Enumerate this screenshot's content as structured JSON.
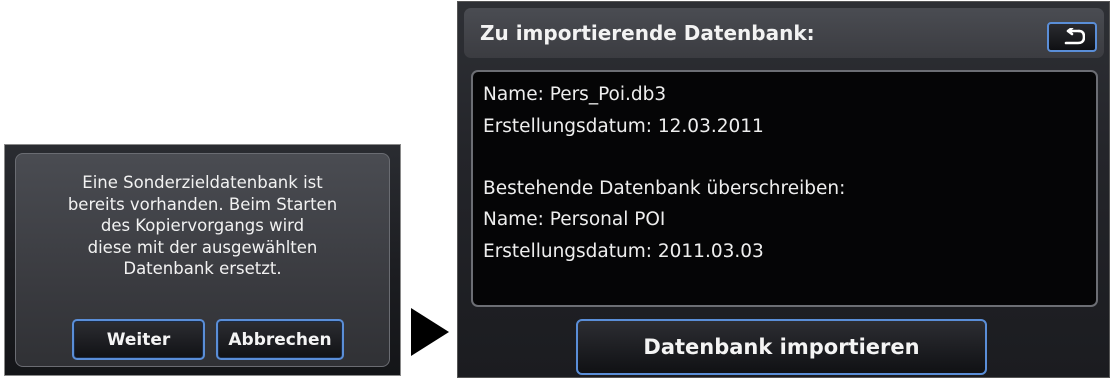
{
  "left_dialog": {
    "message_lines": [
      "Eine Sonderzieldatenbank ist",
      "bereits vorhanden. Beim Starten",
      "des Kopiervorgangs wird",
      "diese mit der ausgewählten",
      "Datenbank ersetzt."
    ],
    "continue_label": "Weiter",
    "cancel_label": "Abbrechen"
  },
  "right_screen": {
    "title": "Zu importierende Datenbank:",
    "back_icon": "back-arrow-icon",
    "info": {
      "name_line": "Name: Pers_Poi.db3",
      "created_line": "Erstellungsdatum:  12.03.2011",
      "overwrite_heading": "Bestehende Datenbank überschreiben:",
      "existing_name_line": "Name: Personal POI",
      "existing_created_line": "Erstellungsdatum: 2011.03.03"
    },
    "import_label": "Datenbank importieren"
  },
  "colors": {
    "button_border": "#5a8ed8",
    "screen_bg": "#1c1d21",
    "text": "#f2f2f2"
  }
}
